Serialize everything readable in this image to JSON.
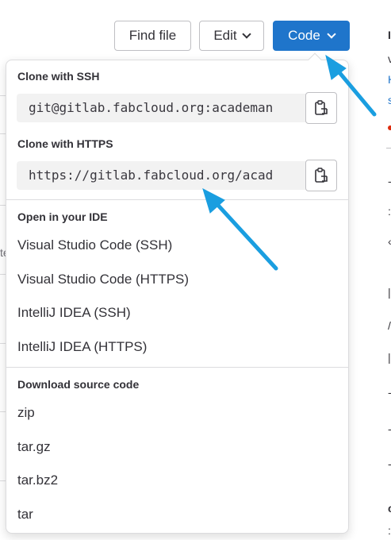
{
  "toolbar": {
    "find_file_label": "Find file",
    "edit_label": "Edit",
    "code_label": "Code"
  },
  "clone": {
    "ssh_title": "Clone with SSH",
    "ssh_url": "git@gitlab.fabcloud.org:academan",
    "https_title": "Clone with HTTPS",
    "https_url": "https://gitlab.fabcloud.org/acad"
  },
  "ide": {
    "title": "Open in your IDE",
    "items": [
      {
        "label": "Visual Studio Code (SSH)"
      },
      {
        "label": "Visual Studio Code (HTTPS)"
      },
      {
        "label": "IntelliJ IDEA (SSH)"
      },
      {
        "label": "IntelliJ IDEA (HTTPS)"
      }
    ]
  },
  "download": {
    "title": "Download source code",
    "items": [
      {
        "label": "zip"
      },
      {
        "label": "tar.gz"
      },
      {
        "label": "tar.bz2"
      },
      {
        "label": "tar"
      }
    ]
  },
  "icons": {
    "copy": "copy-to-clipboard-icon",
    "chevron": "chevron-down-icon"
  },
  "colors": {
    "primary": "#1f75cb",
    "annotation_arrow": "#1a9ee0"
  }
}
